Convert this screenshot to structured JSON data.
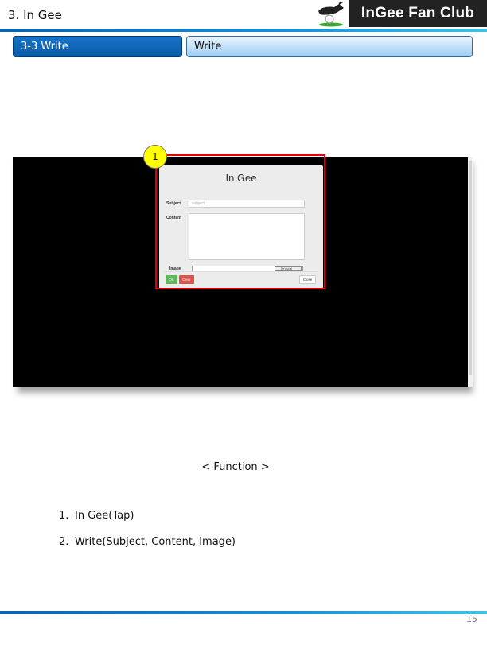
{
  "header": {
    "title": "3. In Gee",
    "logo_text": "InGee Fan Club",
    "logo_icon": "golf-driver-icon"
  },
  "section": {
    "tab_label": "3-3 Write",
    "page_title": "Write"
  },
  "screenshot": {
    "modal": {
      "title": "In Gee",
      "subject_label": "Subject",
      "subject_placeholder": "subject",
      "content_label": "Content",
      "image_label": "Image",
      "file_button_label": "찾아보기...",
      "ok_label": "OK",
      "clear_label": "Clear",
      "close_label": "Close"
    },
    "marker": "1"
  },
  "function": {
    "heading": "< Function >",
    "items": [
      {
        "num": "1.",
        "text": "In Gee(Tap)"
      },
      {
        "num": "2.",
        "text": "Write(Subject, Content, Image)"
      }
    ]
  },
  "footer": {
    "page_number": "15"
  },
  "colors": {
    "accent_blue": "#0a5aa8",
    "highlight_red": "#e00000",
    "marker_yellow": "#ffff00",
    "ok_green": "#5cb85c",
    "clear_red": "#d9534f"
  }
}
